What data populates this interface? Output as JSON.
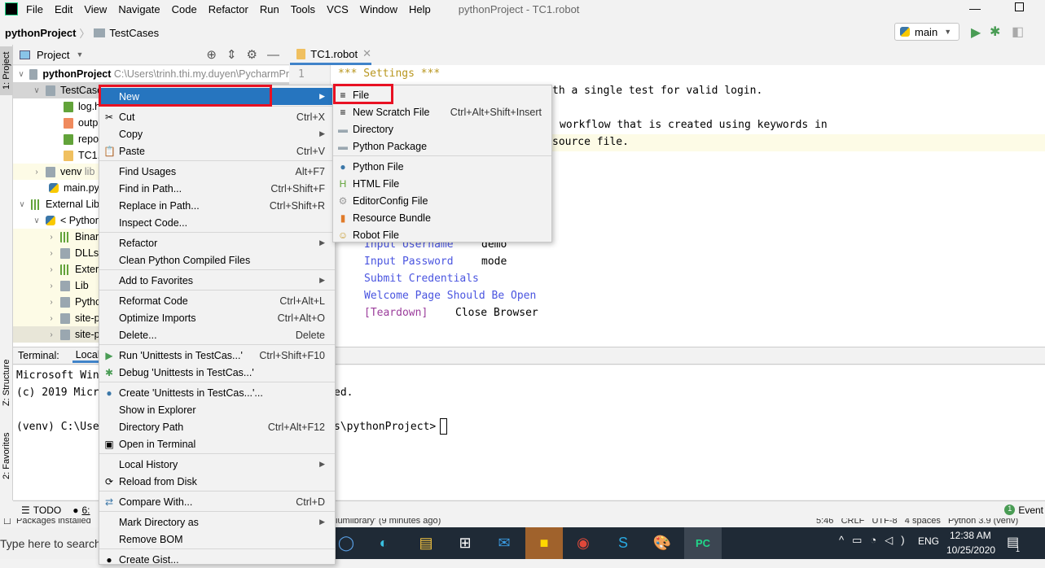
{
  "menubar": {
    "items": [
      "File",
      "Edit",
      "View",
      "Navigate",
      "Code",
      "Refactor",
      "Run",
      "Tools",
      "VCS",
      "Window",
      "Help"
    ],
    "title": "pythonProject - TC1.robot",
    "logo": "PC"
  },
  "breadcrumb": {
    "project": "pythonProject",
    "folder": "TestCases"
  },
  "run_config": {
    "name": "main"
  },
  "toolwindows": {
    "project": "1: Project",
    "structure": "Z: Structure",
    "favorites": "2: Favorites"
  },
  "project_panel": {
    "title": "Project",
    "tree": [
      {
        "label": "pythonProject",
        "extra": "C:\\Users\\trinh.thi.my.duyen\\PycharmPr"
      },
      {
        "label": "TestCases"
      },
      {
        "label": "log.h"
      },
      {
        "label": "outp"
      },
      {
        "label": "repo"
      },
      {
        "label": "TC1.r"
      },
      {
        "label": "venv",
        "extra": "lib"
      },
      {
        "label": "main.py"
      },
      {
        "label": "External Lib"
      },
      {
        "label": "< Python"
      },
      {
        "label": "Binar"
      },
      {
        "label": "DLLs"
      },
      {
        "label": "Exter"
      },
      {
        "label": "Lib"
      },
      {
        "label": "Pytho"
      },
      {
        "label": "site-p"
      },
      {
        "label": "site-p"
      }
    ]
  },
  "editor": {
    "tab": "TC1.robot",
    "line_number": "1",
    "lines": [
      {
        "text": "*** Settings ***",
        "color": "#b8961e"
      },
      {
        "text": "th a single test for valid login.",
        "color": "#000"
      },
      {
        "text": "workflow that is created using keywords in",
        "color": "#000"
      },
      {
        "text": "source file.",
        "color": "#000"
      },
      {
        "text": "Input Username",
        "arg": "demo",
        "color": "#4a55e0"
      },
      {
        "text": "Input Password",
        "arg": "mode",
        "color": "#4a55e0"
      },
      {
        "text": "Submit Credentials",
        "arg": "",
        "color": "#4a55e0"
      },
      {
        "text": "Welcome Page Should Be Open",
        "arg": "",
        "color": "#4a55e0"
      },
      {
        "text": "[Teardown]",
        "arg": "Close Browser",
        "color": "#9b3d9b"
      }
    ]
  },
  "terminal": {
    "label": "Terminal:",
    "tab": "Local",
    "lines": [
      "Microsoft Win",
      "(c) 2019 Micr",
      "",
      "(venv) C:\\Use"
    ],
    "right": [
      "ed.",
      "s\\pythonProject>"
    ]
  },
  "bottom_tabs": {
    "todo": "TODO",
    "problems": "6:",
    "event_log": "Event",
    "event_count": "1"
  },
  "statusbar": {
    "left": "Packages installed",
    "mid": "iumlibrary' (9 minutes ago)",
    "right": "5:46   CRLF   UTF-8   4 spaces   Python 3.9 (venv)"
  },
  "context_menu": [
    {
      "label": "New",
      "submenu": true,
      "highlighted": true
    },
    {
      "sep": true
    },
    {
      "label": "Cut",
      "shortcut": "Ctrl+X",
      "icon": "✂"
    },
    {
      "label": "Copy",
      "submenu": true
    },
    {
      "label": "Paste",
      "shortcut": "Ctrl+V",
      "icon": "📋"
    },
    {
      "sep": true
    },
    {
      "label": "Find Usages",
      "shortcut": "Alt+F7"
    },
    {
      "label": "Find in Path...",
      "shortcut": "Ctrl+Shift+F"
    },
    {
      "label": "Replace in Path...",
      "shortcut": "Ctrl+Shift+R"
    },
    {
      "label": "Inspect Code..."
    },
    {
      "sep": true
    },
    {
      "label": "Refactor",
      "submenu": true
    },
    {
      "label": "Clean Python Compiled Files"
    },
    {
      "sep": true
    },
    {
      "label": "Add to Favorites",
      "submenu": true
    },
    {
      "sep": true
    },
    {
      "label": "Reformat Code",
      "shortcut": "Ctrl+Alt+L"
    },
    {
      "label": "Optimize Imports",
      "shortcut": "Ctrl+Alt+O"
    },
    {
      "label": "Delete...",
      "shortcut": "Delete"
    },
    {
      "sep": true
    },
    {
      "label": "Run 'Unittests in TestCas...'",
      "shortcut": "Ctrl+Shift+F10",
      "icon": "▶",
      "iconColor": "#499c54"
    },
    {
      "label": "Debug 'Unittests in TestCas...'",
      "icon": "✱",
      "iconColor": "#499c54"
    },
    {
      "sep": true
    },
    {
      "label": "Create 'Unittests in TestCas...'...",
      "icon": "●",
      "iconColor": "#3b77a8"
    },
    {
      "label": "Show in Explorer"
    },
    {
      "label": "Directory Path",
      "shortcut": "Ctrl+Alt+F12"
    },
    {
      "label": "Open in Terminal",
      "icon": "▣"
    },
    {
      "sep": true
    },
    {
      "label": "Local History",
      "submenu": true
    },
    {
      "label": "Reload from Disk",
      "icon": "⟳"
    },
    {
      "sep": true
    },
    {
      "label": "Compare With...",
      "shortcut": "Ctrl+D",
      "icon": "⇄",
      "iconColor": "#3b77a8"
    },
    {
      "sep": true
    },
    {
      "label": "Mark Directory as",
      "submenu": true
    },
    {
      "label": "Remove BOM"
    },
    {
      "sep": true
    },
    {
      "label": "Create Gist...",
      "icon": "●"
    }
  ],
  "new_submenu": [
    {
      "label": "File",
      "icon": "≡"
    },
    {
      "label": "New Scratch File",
      "shortcut": "Ctrl+Alt+Shift+Insert",
      "icon": "≡"
    },
    {
      "label": "Directory",
      "icon": "▬",
      "iconColor": "#9aa7b0"
    },
    {
      "label": "Python Package",
      "icon": "▬",
      "iconColor": "#9aa7b0"
    },
    {
      "sep": true
    },
    {
      "label": "Python File",
      "icon": "●",
      "iconColor": "#3b77a8"
    },
    {
      "label": "HTML File",
      "icon": "H",
      "iconColor": "#62a33a"
    },
    {
      "label": "EditorConfig File",
      "icon": "⚙",
      "iconColor": "#999"
    },
    {
      "label": "Resource Bundle",
      "icon": "▮",
      "iconColor": "#e07b2a"
    },
    {
      "label": "Robot File",
      "icon": "☺",
      "iconColor": "#c69a2b"
    }
  ],
  "taskbar": {
    "search_placeholder": "Type here to search",
    "time": "12:38 AM",
    "date": "10/25/2020",
    "lang": "ENG",
    "notif_count": "1"
  }
}
